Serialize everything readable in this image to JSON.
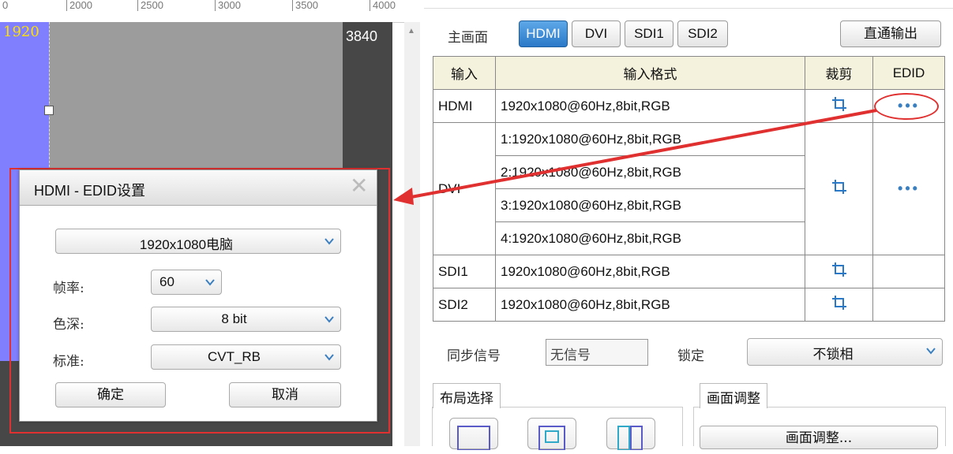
{
  "ruler": {
    "ticks": [
      "2000",
      "2500",
      "3000",
      "3500",
      "4000"
    ],
    "left_label": "0"
  },
  "canvas": {
    "y_value": "1920",
    "width_value": "3840"
  },
  "dialog": {
    "title": "HDMI - EDID设置",
    "preset": "1920x1080电脑",
    "frame_rate_label": "帧率:",
    "frame_rate": "60",
    "color_depth_label": "色深:",
    "color_depth": "8 bit",
    "standard_label": "标准:",
    "standard": "CVT_RB",
    "ok": "确定",
    "cancel": "取消"
  },
  "header": {
    "main_screen_label": "主画面",
    "tabs": [
      "HDMI",
      "DVI",
      "SDI1",
      "SDI2"
    ],
    "active_tab": "HDMI",
    "passthrough": "直通输出"
  },
  "table": {
    "headers": {
      "input": "输入",
      "format": "输入格式",
      "crop": "裁剪",
      "edid": "EDID"
    },
    "rows": [
      {
        "input": "HDMI",
        "formats": [
          "1920x1080@60Hz,8bit,RGB"
        ]
      },
      {
        "input": "DVI",
        "formats": [
          "1:1920x1080@60Hz,8bit,RGB",
          "2:1920x1080@60Hz,8bit,RGB",
          "3:1920x1080@60Hz,8bit,RGB",
          "4:1920x1080@60Hz,8bit,RGB"
        ]
      },
      {
        "input": "SDI1",
        "formats": [
          "1920x1080@60Hz,8bit,RGB"
        ]
      },
      {
        "input": "SDI2",
        "formats": [
          "1920x1080@60Hz,8bit,RGB"
        ]
      }
    ],
    "edid_more": "•••"
  },
  "sync": {
    "label": "同步信号",
    "value": "无信号",
    "lock_label": "锁定",
    "lock_value": "不锁相"
  },
  "layout": {
    "group_label": "布局选择"
  },
  "adjust": {
    "group_label": "画面调整",
    "button": "画面调整..."
  },
  "colors": {
    "accent_blue": "#2a78c8",
    "highlight_red": "#e03030",
    "header_bg": "#f4f1dc"
  }
}
